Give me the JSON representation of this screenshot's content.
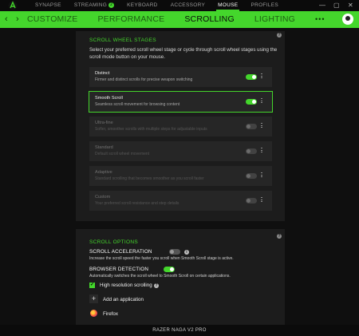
{
  "topnav": {
    "items": [
      {
        "label": "SYNAPSE"
      },
      {
        "label": "STREAMING",
        "badge": "2"
      },
      {
        "label": "KEYBOARD"
      },
      {
        "label": "ACCESSORY"
      },
      {
        "label": "MOUSE"
      },
      {
        "label": "PROFILES"
      }
    ],
    "active": "MOUSE"
  },
  "window_controls": {
    "minimize": "—",
    "maximize": "▢",
    "close": "✕"
  },
  "subnav": {
    "back": "‹",
    "forward": "›",
    "tabs": [
      {
        "label": "CUSTOMIZE"
      },
      {
        "label": "PERFORMANCE"
      },
      {
        "label": "SCROLLING"
      },
      {
        "label": "LIGHTING"
      },
      {
        "label": "•••"
      }
    ],
    "active": "SCROLLING"
  },
  "stages_panel": {
    "title": "SCROLL WHEEL STAGES",
    "description": "Select your preferred scroll wheel stage or cycle through scroll wheel stages using the scroll mode button on your mouse.",
    "stages": [
      {
        "name": "Distinct",
        "sub": "Firmer and distinct scrolls for precise weapon switching",
        "on": true,
        "selected": false,
        "enabled": true
      },
      {
        "name": "Smooth Scroll",
        "sub": "Seamless scroll movement for browsing content",
        "on": true,
        "selected": true,
        "enabled": true
      },
      {
        "name": "Ultra-fine",
        "sub": "Softer, smoother scrolls with multiple steps for adjustable inputs",
        "on": false,
        "selected": false,
        "enabled": false
      },
      {
        "name": "Standard",
        "sub": "Default scroll wheel movement",
        "on": false,
        "selected": false,
        "enabled": false
      },
      {
        "name": "Adaptive",
        "sub": "Standard scrolling that becomes smoother as you scroll faster",
        "on": false,
        "selected": false,
        "enabled": false
      },
      {
        "name": "Custom",
        "sub": "Your preferred scroll resistance and step details",
        "on": false,
        "selected": false,
        "enabled": false
      }
    ]
  },
  "options_panel": {
    "title": "SCROLL OPTIONS",
    "acceleration": {
      "label": "SCROLL ACCELERATION",
      "sub": "Increase the scroll speed the faster you scroll when Smooth Scroll stage is active.",
      "on": false
    },
    "browser": {
      "label": "BROWSER DETECTION",
      "sub": "Automatically switches the scroll wheel to Smooth Scroll on certain applications.",
      "on": true
    },
    "high_res": {
      "label": "High resolution scrolling",
      "checked": true
    },
    "add_app": {
      "label": "Add an application"
    },
    "apps": [
      {
        "name": "Firefox"
      }
    ]
  },
  "footer": {
    "device": "RAZER NAGA V2 PRO"
  },
  "colors": {
    "accent": "#44d62c",
    "panel": "#1c1c1c",
    "background": "#0f0f0f"
  }
}
